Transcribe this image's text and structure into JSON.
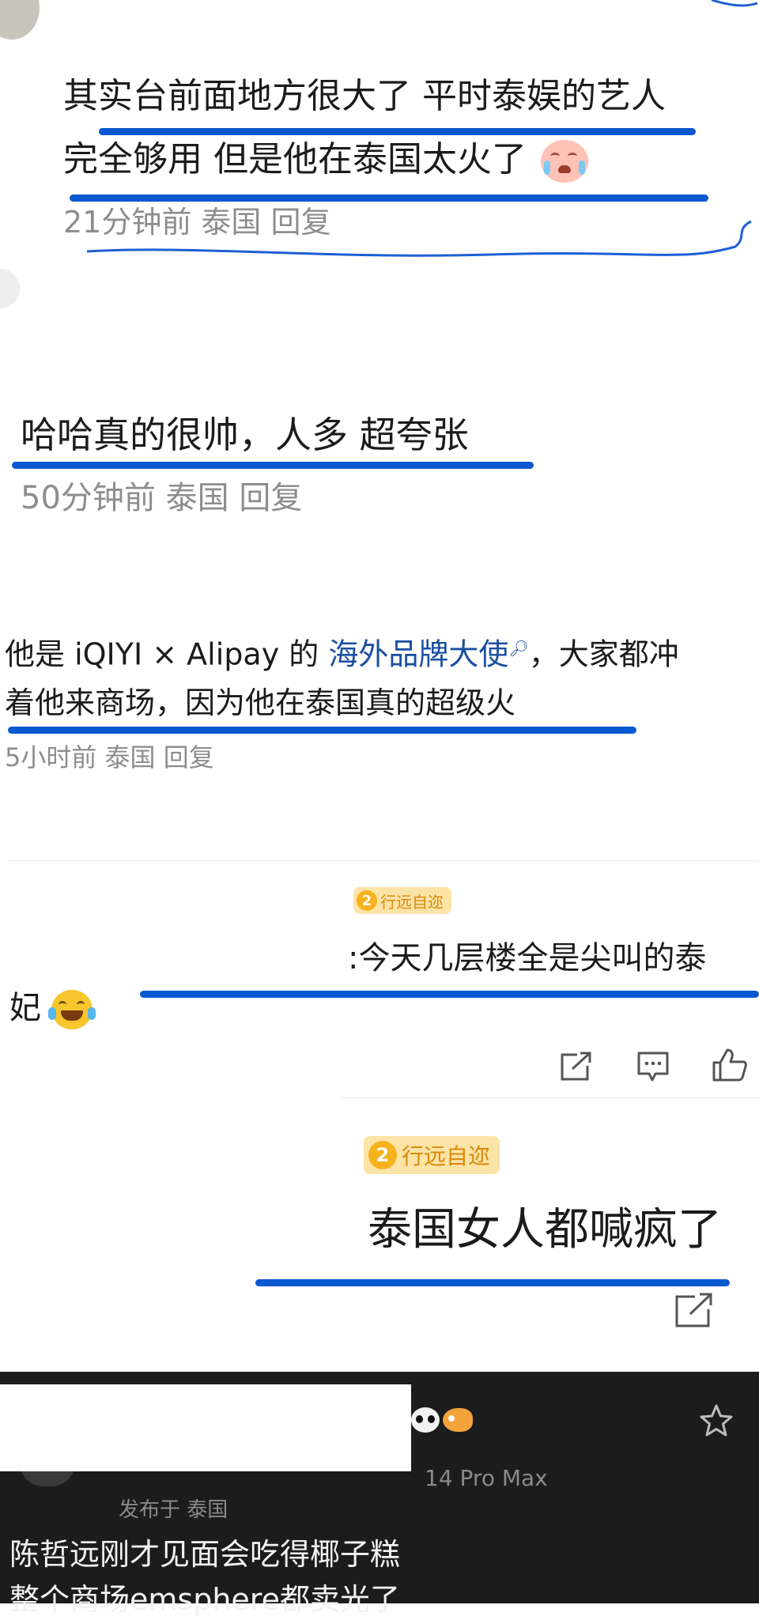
{
  "comment1": {
    "line1": "其实台前面地方很大了 平时泰娱的艺人",
    "line2": "完全够用 但是他在泰国太火了",
    "meta": "21分钟前 泰国 回复"
  },
  "comment2": {
    "text": "哈哈真的很帅，人多 超夸张",
    "meta": "50分钟前 泰国 回复"
  },
  "comment3": {
    "line1_prefix": "他是 iQIYI × Alipay 的 ",
    "line1_link": "海外品牌大使",
    "line1_suffix": "，大家都冲",
    "line2": "着他来商场，因为他在泰国真的超级火",
    "meta": "5小时前 泰国 回复"
  },
  "comment4": {
    "badge_level": "2",
    "badge_name": "行远自迩",
    "line1": ":今天几层楼全是尖叫的泰",
    "line2": "妃"
  },
  "comment5": {
    "badge_level": "2",
    "badge_name": "行远自迩",
    "text": "泰国女人都喊疯了"
  },
  "post": {
    "device": "14 Pro Max",
    "location": "发布于 泰国",
    "line1": "陈哲远刚才见面会吃得椰子糕",
    "line2": "整个商场emsphere都卖光了"
  },
  "colors": {
    "underline": "#0a58d0",
    "link": "#1a4fa0",
    "meta": "#8d8d8d",
    "dark_bg": "#1c1c1c"
  }
}
